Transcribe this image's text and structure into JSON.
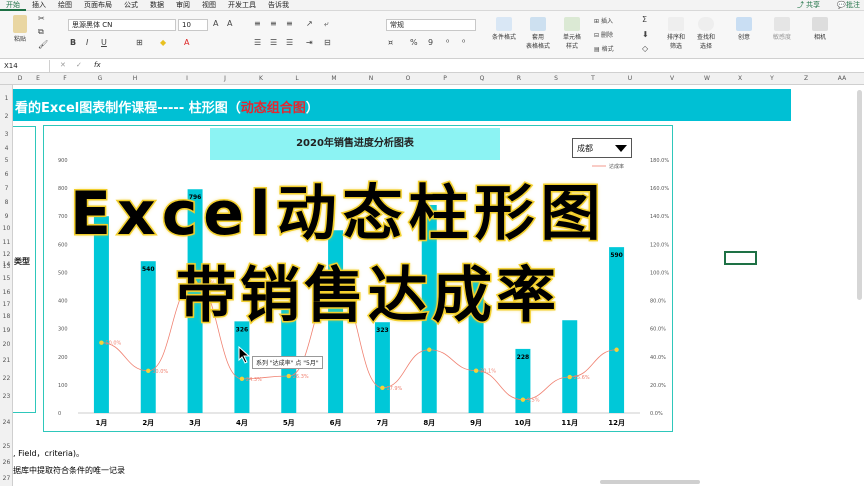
{
  "ribbon_tabs": [
    "开始",
    "插入",
    "绘图",
    "页面布局",
    "公式",
    "数据",
    "审阅",
    "视图",
    "开发工具",
    "告诉我"
  ],
  "share_label": "共享",
  "comment_label": "批注",
  "ribbon": {
    "paste": "粘贴",
    "font_name": "思源黑体 CN",
    "font_size": "10",
    "number_format": "常规",
    "cond_format": "条件格式",
    "table_format": "套用\n表格格式",
    "cell_style": "单元格\n样式",
    "insert": "插入",
    "delete": "删除",
    "format": "格式",
    "sort_filter": "排序和\n筛选",
    "find_select": "查找和\n选择",
    "create": "创意",
    "sensitivity": "敏感度",
    "camera": "相机",
    "bold": "B",
    "italic": "I",
    "underline": "U",
    "percent": "%",
    "comma": "9"
  },
  "name_box": "X14",
  "fx": "fx",
  "columns": [
    "D",
    "E",
    "F",
    "G",
    "H",
    "I",
    "J",
    "K",
    "L",
    "M",
    "N",
    "O",
    "P",
    "Q",
    "R",
    "S",
    "T",
    "U",
    "V",
    "W",
    "X",
    "Y",
    "Z",
    "AA"
  ],
  "rows": [
    "1",
    "2",
    "3",
    "4",
    "5",
    "6",
    "7",
    "8",
    "9",
    "10",
    "11",
    "12",
    "13",
    "14",
    "15",
    "16",
    "17",
    "18",
    "19",
    "20",
    "21",
    "22",
    "23",
    "24",
    "25",
    "26",
    "27"
  ],
  "banner_text": "看的Excel图表制作课程----- 柱形图（",
  "banner_red": "动态组合图",
  "banner_end": "）",
  "left_label": "类型",
  "chart_title": "2020年销售进度分析图表",
  "dropdown_value": "成都",
  "legend_rate": "达成率",
  "overlay_line1": "Excel动态柱形图",
  "overlay_line2": "带销售达成率",
  "tooltip": "系列 \"达成率\" 点 \"5月\"",
  "bottom_line1": ", Field，criteria)。",
  "bottom_line2": "据库中提取符合条件的唯一记录",
  "chart_data": {
    "type": "bar",
    "categories": [
      "1月",
      "2月",
      "3月",
      "4月",
      "5月",
      "6月",
      "7月",
      "8月",
      "9月",
      "10月",
      "11月",
      "12月"
    ],
    "bars": [
      700,
      540,
      796,
      326,
      380,
      650,
      323,
      740,
      470,
      228,
      330,
      590
    ],
    "bar_labels": [
      "",
      "540",
      "796",
      "326",
      "",
      "",
      "323",
      "",
      "",
      "228",
      "",
      "590"
    ],
    "rate": [
      0.5,
      0.3,
      0.93,
      0.243,
      0.263,
      0.9,
      0.179,
      0.45,
      0.301,
      0.095,
      0.256,
      0.45
    ],
    "rate_labels": [
      "50.0%",
      "30.0%",
      "93.3%",
      "24.3%",
      "26.3%",
      "90.0%",
      "17.9%",
      "",
      "30.1%",
      "9.5%",
      "25.6%",
      ""
    ],
    "ylim": [
      0,
      900
    ],
    "yticks": [
      "0",
      "100",
      "200",
      "300",
      "400",
      "500",
      "600",
      "700",
      "800",
      "900"
    ],
    "y2ticks": [
      "0.0%",
      "20.0%",
      "40.0%",
      "60.0%",
      "80.0%",
      "100.0%",
      "120.0%",
      "140.0%",
      "160.0%",
      "180.0%"
    ],
    "y2lim": [
      0,
      1.8
    ],
    "bar_color": "#00c8d8",
    "line_color": "#f08070"
  }
}
